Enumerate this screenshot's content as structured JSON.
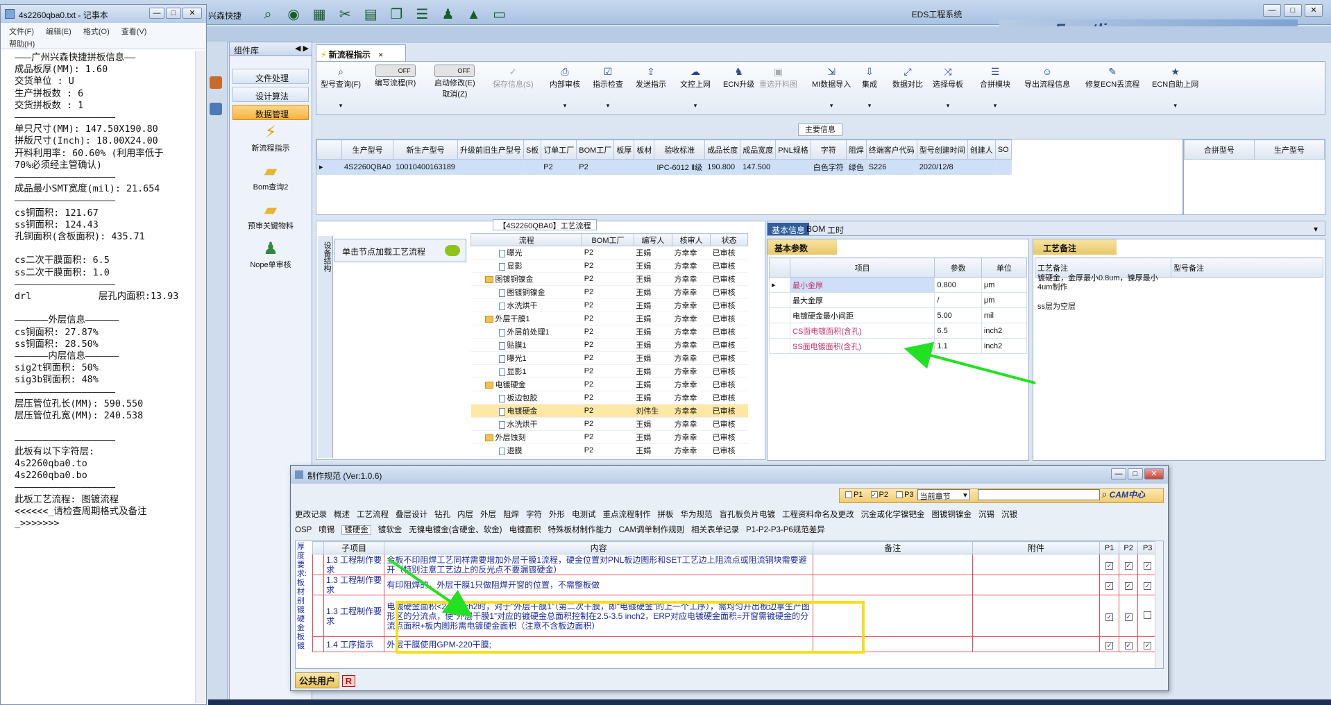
{
  "eds": {
    "title": "EDS工程系统",
    "app_short": "兴森快捷",
    "brand": "Frontline",
    "window_controls": [
      "—",
      "□",
      "✕"
    ]
  },
  "sidebar": {
    "header": "组件库",
    "items": [
      {
        "label": "文件处理"
      },
      {
        "label": "设计算法"
      },
      {
        "label": "数据管理"
      }
    ],
    "tools": [
      {
        "label": "新流程指示",
        "icon": "lightning-icon"
      },
      {
        "label": "Bom查询2",
        "icon": "folder-icon"
      },
      {
        "label": "预审关键物料",
        "icon": "folder-icon"
      },
      {
        "label": "Nope单审核",
        "icon": "user-icon"
      }
    ]
  },
  "doc_tab": {
    "label": "新流程指示"
  },
  "ribbon": {
    "model_query": "型号查询(F)",
    "edit_flow": "编写流程(R)",
    "startup_modify": "启动修改(E)",
    "cancel": "取消(Z)",
    "toggle_off": "OFF",
    "buttons": [
      {
        "label": "保存信息(S)",
        "disabled": true
      },
      {
        "label": "内部审核"
      },
      {
        "label": "指示检查"
      },
      {
        "label": "发送指示"
      },
      {
        "label": "文控上网"
      },
      {
        "label": "ECN升级"
      },
      {
        "label": "重选开料图",
        "disabled": true
      },
      {
        "label": "MI数据导入"
      },
      {
        "label": "集成"
      },
      {
        "label": "数据对比"
      },
      {
        "label": "选择母板"
      },
      {
        "label": "合拼模块"
      },
      {
        "label": "导出流程信息"
      },
      {
        "label": "修复ECN丢流程"
      },
      {
        "label": "ECN自助上网"
      }
    ]
  },
  "main_info": {
    "caption": "主要信息",
    "columns": [
      "生产型号",
      "新生产型号",
      "升级前旧生产型号",
      "S板",
      "订单工厂",
      "BOM工厂",
      "板厚",
      "板材",
      "验收标准",
      "成品长度",
      "成品宽度",
      "PNL规格",
      "字符",
      "阻焊",
      "终端客户代码",
      "型号创建时间",
      "创建人",
      "SO"
    ],
    "row": [
      "4S2260QBA0",
      "10010400163189",
      "",
      "",
      "P2",
      "P2",
      "",
      "",
      "IPC-6012 Ⅱ级",
      "190.800",
      "147.500",
      "",
      "白色字符",
      "绿色",
      "S226",
      "2020/12/8",
      "",
      ""
    ],
    "side_columns": [
      "合拼型号",
      "生产型号"
    ]
  },
  "flow": {
    "caption": "【4S2260QBA0】工艺流程",
    "device_label": "设备结构",
    "node_load": "单击节点加载工艺流程",
    "columns": [
      "流程",
      "BOM工厂",
      "编写人",
      "核审人",
      "状态"
    ],
    "rows": [
      {
        "name": "曝光",
        "level": 2,
        "type": "file",
        "bom": "P2",
        "writer": "王娟",
        "reviewer": "方幸幸",
        "status": "已审核"
      },
      {
        "name": "显影",
        "level": 2,
        "type": "file",
        "bom": "P2",
        "writer": "王娟",
        "reviewer": "方幸幸",
        "status": "已审核"
      },
      {
        "name": "图镀铜镍金",
        "level": 1,
        "type": "folder",
        "bom": "P2",
        "writer": "王娟",
        "reviewer": "方幸幸",
        "status": "已审核"
      },
      {
        "name": "图镀铜镍金",
        "level": 2,
        "type": "file",
        "bom": "P2",
        "writer": "王娟",
        "reviewer": "方幸幸",
        "status": "已审核"
      },
      {
        "name": "水洗烘干",
        "level": 2,
        "type": "file",
        "bom": "P2",
        "writer": "王娟",
        "reviewer": "方幸幸",
        "status": "已审核"
      },
      {
        "name": "外层干膜1",
        "level": 1,
        "type": "folder",
        "bom": "P2",
        "writer": "王娟",
        "reviewer": "方幸幸",
        "status": "已审核"
      },
      {
        "name": "外层前处理1",
        "level": 2,
        "type": "file",
        "bom": "P2",
        "writer": "王娟",
        "reviewer": "方幸幸",
        "status": "已审核"
      },
      {
        "name": "贴膜1",
        "level": 2,
        "type": "file",
        "bom": "P2",
        "writer": "王娟",
        "reviewer": "方幸幸",
        "status": "已审核"
      },
      {
        "name": "曝光1",
        "level": 2,
        "type": "file",
        "bom": "P2",
        "writer": "王娟",
        "reviewer": "方幸幸",
        "status": "已审核"
      },
      {
        "name": "显影1",
        "level": 2,
        "type": "file",
        "bom": "P2",
        "writer": "王娟",
        "reviewer": "方幸幸",
        "status": "已审核"
      },
      {
        "name": "电镀硬金",
        "level": 1,
        "type": "folder",
        "bom": "P2",
        "writer": "王娟",
        "reviewer": "方幸幸",
        "status": "已审核"
      },
      {
        "name": "板边包胶",
        "level": 2,
        "type": "file",
        "bom": "P2",
        "writer": "王娟",
        "reviewer": "方幸幸",
        "status": "已审核"
      },
      {
        "name": "电镀硬金",
        "level": 2,
        "type": "file",
        "bom": "P2",
        "writer": "刘伟生",
        "reviewer": "方幸幸",
        "status": "已审核",
        "selected": true
      },
      {
        "name": "水洗烘干",
        "level": 2,
        "type": "file",
        "bom": "P2",
        "writer": "王娟",
        "reviewer": "方幸幸",
        "status": "已审核"
      },
      {
        "name": "外层蚀刻",
        "level": 1,
        "type": "folder",
        "bom": "P2",
        "writer": "王娟",
        "reviewer": "方幸幸",
        "status": "已审核"
      },
      {
        "name": "退膜",
        "level": 2,
        "type": "file",
        "bom": "P2",
        "writer": "王娟",
        "reviewer": "方幸幸",
        "status": "已审核"
      }
    ]
  },
  "basic": {
    "tabs": [
      "基本信息",
      "BOM",
      "工时"
    ],
    "section": "基本参数",
    "columns": [
      "项目",
      "参数",
      "单位"
    ],
    "rows": [
      {
        "item": "最小金厚",
        "value": "0.800",
        "unit": "μm",
        "style": "red",
        "selected": true
      },
      {
        "item": "最大金厚",
        "value": "/",
        "unit": "μm"
      },
      {
        "item": "电镀硬金最小间距",
        "value": "5.00",
        "unit": "mil"
      },
      {
        "item": "CS面电镀面积(含孔)",
        "value": "6.5",
        "unit": "inch2",
        "style": "red"
      },
      {
        "item": "SS面电镀面积(含孔)",
        "value": "1.1",
        "unit": "inch2",
        "style": "red"
      }
    ]
  },
  "proc_notes": {
    "section": "工艺备注",
    "columns": [
      "工艺备注",
      "型号备注"
    ],
    "note": "镀硬金，金厚最小0.8um，镍厚最小4um制作",
    "note2": "ss层为空层"
  },
  "notepad": {
    "title": "4s2260qba0.txt - 记事本",
    "menu": [
      "文件(F)",
      "编辑(E)",
      "格式(O)",
      "查看(V)",
      "帮助(H)"
    ],
    "lines": [
      "———广州兴森快捷拼板信息——",
      "成品板厚(MM): 1.60",
      "交货单位 : U",
      "生产拼板数 : 6",
      "交货拼板数 : 1",
      "——————————————————",
      "单只尺寸(MM): 147.50X190.80",
      "拼版尺寸(Inch): 18.00X24.00",
      "开料利用率: 60.60% (利用率低于",
      "70%必须经主管确认)",
      "——————————————————",
      "成品最小SMT宽度(mil): 21.654",
      "——————————————————",
      "cs铜面积: 121.67",
      "ss铜面积: 124.43",
      "孔铜面积(含板面积): 435.71",
      "",
      "cs二次干膜面积: 6.5",
      "ss二次干膜面积: 1.0",
      "——————————————————",
      "drl            层孔内面积:13.93",
      "",
      "——————外层信息——————",
      "cs铜面积: 27.87%",
      "ss铜面积: 28.50%",
      "——————内层信息——————",
      "sig2t铜面积: 50%",
      "sig3b铜面积: 48%",
      "——————————————————",
      "层压管位孔长(MM): 590.550",
      "层压管位孔宽(MM): 240.538",
      "",
      "——————————————————",
      "此板有以下字符层:",
      "4s2260qba0.to",
      "4s2260qba0.bo",
      "——————————————————",
      "此板工艺流程: 图镀流程",
      "<<<<<<_请检查周期格式及备注",
      "_>>>>>>>"
    ]
  },
  "spec": {
    "title": "制作规范 (Ver:1.0.6)",
    "filter": {
      "p1": "P1",
      "p2": "P2",
      "p3": "P3",
      "chapter": "当前章节"
    },
    "cam_label": "CAM中心",
    "tabs_row1": [
      "更改记录",
      "概述",
      "工艺流程",
      "叠层设计",
      "钻孔",
      "内层",
      "外层",
      "阻焊",
      "字符",
      "外形",
      "电测试",
      "重点流程制作",
      "拼板",
      "华为规范",
      "盲孔板负片电镀",
      "工程资料命名及更改",
      "沉金或化学镍钯金",
      "图镀铜镍金",
      "沉锡",
      "沉银"
    ],
    "tabs_row2": [
      "OSP",
      "喷锡",
      "镀硬金",
      "镀软金",
      "无镍电镀金(含硬金、软金)",
      "电镀面积",
      "特殊板材制作能力",
      "CAM调单制作规则",
      "相关表单记录",
      "P1-P2-P3-P6规范差异"
    ],
    "active_tab": "镀硬金",
    "left_col_text": "厚度要求: 板材别镀硬金板镀",
    "columns": [
      "子项目",
      "内容",
      "备注",
      "附件",
      "P1",
      "P2",
      "P3"
    ],
    "rows": [
      {
        "sub": "1.3 工程制作要求",
        "content": "金板不印阻焊工艺同样需要增加外层干膜1流程，硬金位置对PNL板边图形和SET工艺边上阻流点或阻流铜块需要避开（特别注意工艺边上的反光点不要漏镀硬金）",
        "p": [
          true,
          true,
          true
        ]
      },
      {
        "sub": "1.3 工程制作要求",
        "content": "有印阻焊的，外层干膜1只做阻焊开窗的位置，不需整板做",
        "p": [
          true,
          true,
          true
        ]
      },
      {
        "sub": "1.3 工程制作要求",
        "content": "电镀硬金面积<2.16inch2时，对于“外层干膜1”（第二次干膜，即“电镀硬金”的上一个工序），需均匀开出板边拿生产图形区的分流点，使“外层干膜1”对应的镀硬金总面积控制在2.5-3.5 inch2，ERP对应电镀硬金面积=开窗需镀硬金的分流点面积+板内图形需电镀硬金面积（注意不含板边面积）",
        "p": [
          true,
          true,
          false
        ]
      },
      {
        "sub": "1.4 工序指示",
        "content": "外层干膜使用GPM-220干膜;",
        "p": [
          true,
          true,
          true
        ]
      }
    ],
    "user": "公共用户",
    "user_badge": "R"
  }
}
